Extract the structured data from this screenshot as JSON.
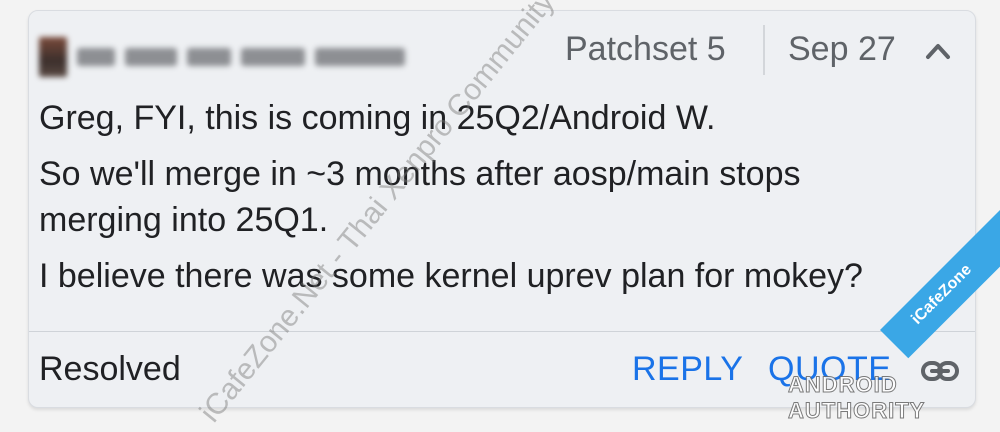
{
  "comment": {
    "author_name_blurred": "",
    "patchset_label": "Patchset 5",
    "date": "Sep 27",
    "messages": [
      "Greg, FYI, this is coming in 25Q2/Android W.",
      "So we'll merge in ~3 months after aosp/main stops\nmerging into 25Q1.",
      "I believe there was some kernel uprev plan for mokey?"
    ],
    "status": "Resolved",
    "reply_label": "REPLY",
    "quote_label": "QUOTE"
  },
  "icons": {
    "collapse": "chevron-up-icon",
    "link": "link-icon"
  },
  "watermarks": {
    "diagonal": "iCafeZone.Net - Thai Xenpro Community",
    "brand": "ANDROID AUTHORITY",
    "ribbon": "iCafeZone"
  },
  "colors": {
    "card_bg": "#eef0f3",
    "text_primary": "#202124",
    "text_secondary": "#5f6368",
    "action_blue": "#1a73e8"
  }
}
